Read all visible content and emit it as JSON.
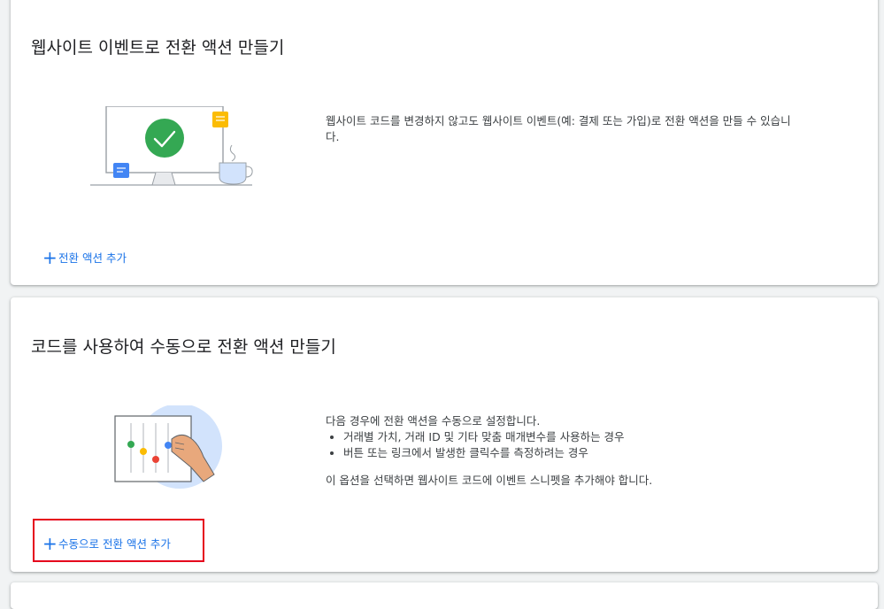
{
  "sections": [
    {
      "title": "웹사이트 이벤트로 전환 액션 만들기",
      "description": "웹사이트 코드를 변경하지 않고도 웹사이트 이벤트(예: 결제 또는 가입)로 전환 액션을 만들 수 있습니다.",
      "add_label": "전환 액션 추가",
      "illustration": "monitor-checkmark-icon"
    },
    {
      "title": "코드를 사용하여 수동으로 전환 액션 만들기",
      "description": "다음 경우에 전환 액션을 수동으로 설정합니다.",
      "bullets": [
        "거래별 가치, 거래 ID 및 기타 맞춤 매개변수를 사용하는 경우",
        "버튼 또는 링크에서 발생한 클릭수를 측정하려는 경우"
      ],
      "note": "이 옵션을 선택하면 웹사이트 코드에 이벤트 스니펫을 추가해야 합니다.",
      "add_label": "수동으로 전환 액션 추가",
      "illustration": "sliders-hand-icon"
    }
  ],
  "colors": {
    "link": "#1a73e8",
    "highlight": "#e5001c",
    "success": "#34a853"
  }
}
